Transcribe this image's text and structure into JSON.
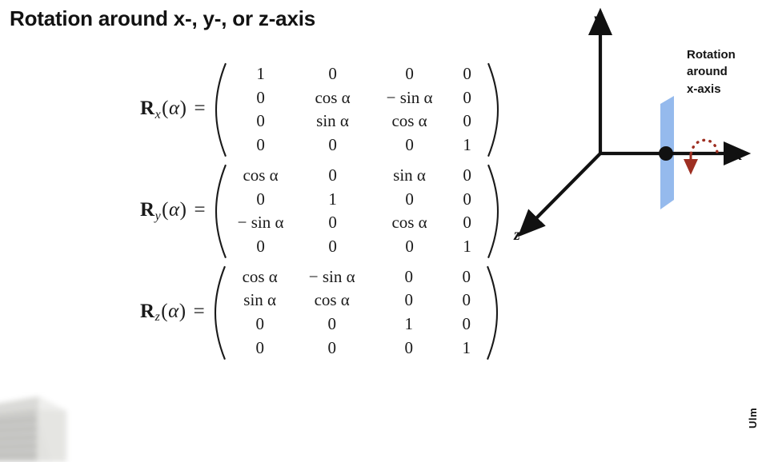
{
  "slide": {
    "title": "Rotation around x-, y-, or z-axis",
    "background_color": "#ffffff"
  },
  "equations": [
    {
      "name": "rotation-matrix-x",
      "label_R": "R",
      "label_subscript": "x",
      "label_arg_open": "(",
      "label_alpha": "α",
      "label_arg_close": ")",
      "label_equals": "=",
      "rows": [
        [
          "1",
          "0",
          "0",
          "0"
        ],
        [
          "0",
          "cos α",
          "− sin α",
          "0"
        ],
        [
          "0",
          "sin α",
          "cos α",
          "0"
        ],
        [
          "0",
          "0",
          "0",
          "1"
        ]
      ]
    },
    {
      "name": "rotation-matrix-y",
      "label_R": "R",
      "label_subscript": "y",
      "label_arg_open": "(",
      "label_alpha": "α",
      "label_arg_close": ")",
      "label_equals": "=",
      "rows": [
        [
          "cos α",
          "0",
          "sin α",
          "0"
        ],
        [
          "0",
          "1",
          "0",
          "0"
        ],
        [
          "− sin α",
          "0",
          "cos α",
          "0"
        ],
        [
          "0",
          "0",
          "0",
          "1"
        ]
      ]
    },
    {
      "name": "rotation-matrix-z",
      "label_R": "R",
      "label_subscript": "z",
      "label_arg_open": "(",
      "label_alpha": "α",
      "label_arg_close": ")",
      "label_equals": "=",
      "rows": [
        [
          "cos α",
          "− sin α",
          "0",
          "0"
        ],
        [
          "sin α",
          "cos α",
          "0",
          "0"
        ],
        [
          "0",
          "0",
          "1",
          "0"
        ],
        [
          "0",
          "0",
          "0",
          "1"
        ]
      ]
    }
  ],
  "diagram": {
    "axis_labels": {
      "y": "y",
      "x": "x",
      "z": "z"
    },
    "annotation_lines": [
      "Rotation",
      "around",
      "x-axis"
    ],
    "colors": {
      "plane": "#8cb4ec",
      "plane_edge": "#6f9fe0",
      "axis": "#111111",
      "rotation_arrow": "#9e2f22",
      "origin_dot": "#111111"
    }
  },
  "overlay": {
    "edge_text": "Ulm"
  }
}
